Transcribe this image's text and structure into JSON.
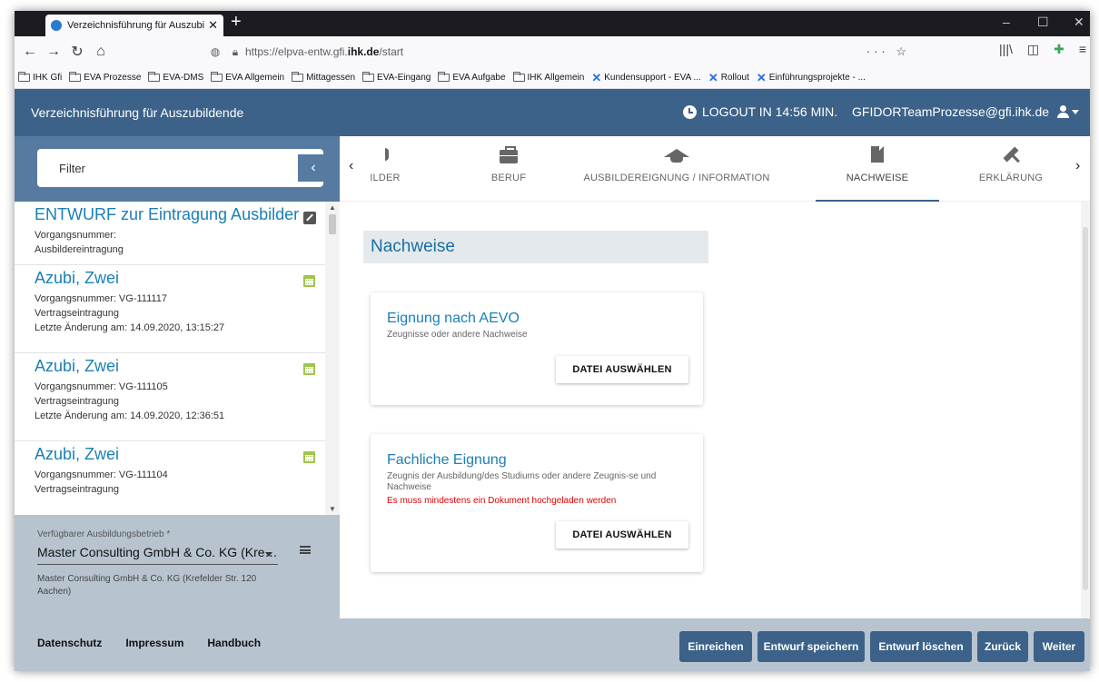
{
  "browser": {
    "tab_title": "Verzeichnisführung für Auszubi",
    "url_prefix": "https://elpva-entw.gfi.",
    "url_host": "ihk.de",
    "url_path": "/start",
    "bookmarks": [
      "IHK Gfi",
      "EVA Prozesse",
      "EVA-DMS",
      "EVA Allgemein",
      "Mittagessen",
      "EVA-Eingang",
      "EVA Aufgabe",
      "IHK Allgemein",
      "Kundensupport - EVA ...",
      "Rollout",
      "Einführungsprojekte - ..."
    ]
  },
  "header": {
    "title": "Verzeichnisführung für Auszubildende",
    "logout": "LOGOUT IN 14:56 MIN.",
    "user": "GFIDORTeamProzesse@gfi.ihk.de"
  },
  "sidebar": {
    "filter_label": "Filter",
    "items": [
      {
        "name": "ENTWURF zur Eintragung Ausbilder",
        "line1": "Vorgangsnummer:",
        "line2": "Ausbildereintragung",
        "line3": ""
      },
      {
        "name": "Azubi, Zwei",
        "line1": "Vorgangsnummer: VG-111117",
        "line2": "Vertragseintragung",
        "line3": "Letzte Änderung am: 14.09.2020, 13:15:27"
      },
      {
        "name": "Azubi, Zwei",
        "line1": "Vorgangsnummer: VG-111105",
        "line2": "Vertragseintragung",
        "line3": "Letzte Änderung am: 14.09.2020, 12:36:51"
      },
      {
        "name": "Azubi, Zwei",
        "line1": "Vorgangsnummer: VG-111104",
        "line2": "Vertragseintragung",
        "line3": ""
      }
    ],
    "betrieb_label": "Verfügbarer Ausbildungsbetrieb *",
    "betrieb_value": "Master Consulting GmbH & Co. KG (Kre…",
    "betrieb_address": "Master Consulting GmbH & Co. KG (Krefelder Str. 120 Aachen)",
    "footer_links": [
      "Datenschutz",
      "Impressum",
      "Handbuch"
    ]
  },
  "tabs": [
    {
      "label": "ILDER",
      "icon": "person-icon"
    },
    {
      "label": "BERUF",
      "icon": "briefcase-icon"
    },
    {
      "label": "AUSBILDEREIGNUNG / INFORMATION",
      "icon": "graduation-cap-icon"
    },
    {
      "label": "NACHWEISE",
      "icon": "file-icon"
    },
    {
      "label": "ERKLÄRUNG",
      "icon": "gavel-icon"
    }
  ],
  "main": {
    "section_title": "Nachweise",
    "cards": [
      {
        "title": "Eignung nach AEVO",
        "subtitle": "Zeugnisse oder andere Nachweise",
        "error": "",
        "button": "DATEI AUSWÄHLEN"
      },
      {
        "title": "Fachliche Eignung",
        "subtitle": "Zeugnis der Ausbildung/des Studiums oder andere Zeugnis-se und Nachweise",
        "error": "Es muss mindestens ein Dokument hochgeladen werden",
        "button": "DATEI AUSWÄHLEN"
      }
    ]
  },
  "actions": {
    "einreichen": "Einreichen",
    "speichern": "Entwurf speichern",
    "loeschen": "Entwurf löschen",
    "zurueck": "Zurück",
    "weiter": "Weiter"
  },
  "colors": {
    "header_bg": "#3c6289",
    "filter_bg": "#577aa1",
    "link_blue": "#1a7fb6",
    "error_red": "#e00000"
  }
}
